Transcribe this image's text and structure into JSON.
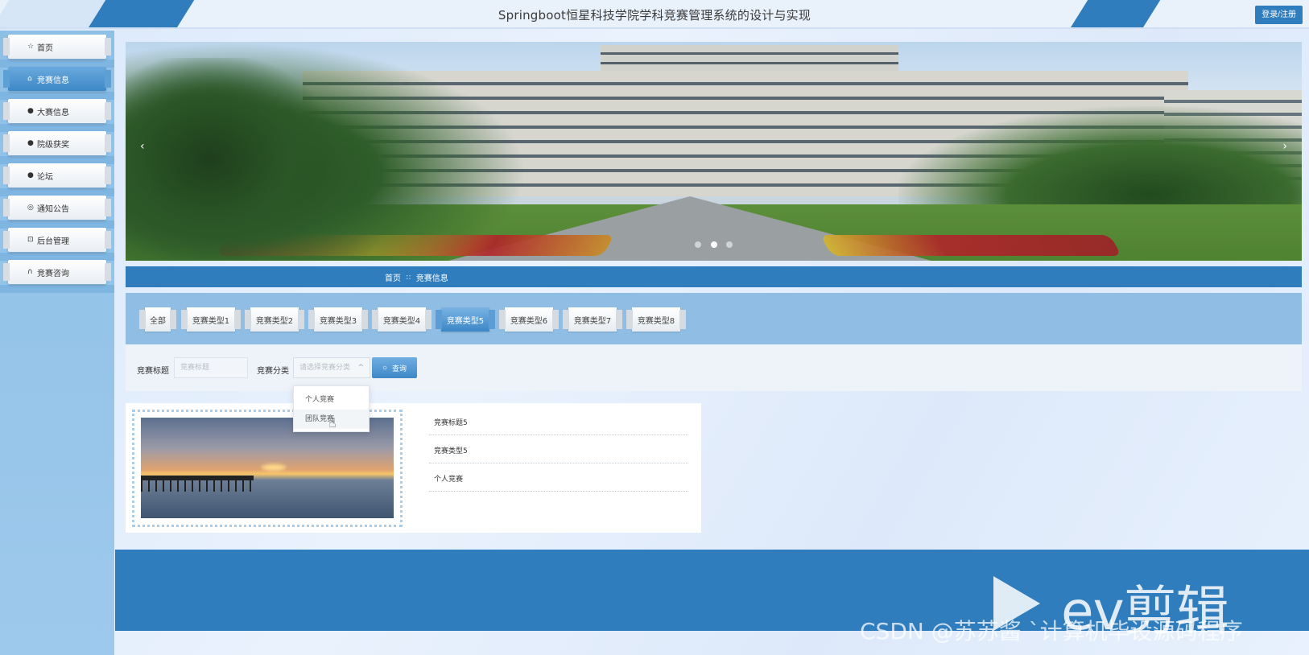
{
  "header": {
    "title": "Springboot恒星科技学院学科竞赛管理系统的设计与实现",
    "login_label": "登录/注册"
  },
  "sidebar": {
    "items": [
      {
        "label": "首页",
        "icon": "star-icon",
        "glyph": "☆"
      },
      {
        "label": "竞赛信息",
        "icon": "home-icon",
        "glyph": "⌂"
      },
      {
        "label": "大赛信息",
        "icon": "info-circle-icon",
        "glyph": "●"
      },
      {
        "label": "院级获奖",
        "icon": "question-circle-icon",
        "glyph": "●"
      },
      {
        "label": "论坛",
        "icon": "info-icon",
        "glyph": "●"
      },
      {
        "label": "通知公告",
        "icon": "settings-icon",
        "glyph": "◎"
      },
      {
        "label": "后台管理",
        "icon": "lock-icon",
        "glyph": "⊡"
      },
      {
        "label": "竞赛咨询",
        "icon": "headset-icon",
        "glyph": "∩"
      }
    ],
    "active_index": 1
  },
  "banner": {
    "prev_glyph": "‹",
    "next_glyph": "›",
    "slide_count": 3,
    "active_slide": 2
  },
  "breadcrumb": {
    "home": "首页",
    "separator": "::",
    "current": "竞赛信息"
  },
  "tabs": {
    "items": [
      "全部",
      "竞赛类型1",
      "竞赛类型2",
      "竞赛类型3",
      "竞赛类型4",
      "竞赛类型5",
      "竞赛类型6",
      "竞赛类型7",
      "竞赛类型8"
    ],
    "active_index": 5
  },
  "search": {
    "title_label": "竞赛标题",
    "title_placeholder": "竞赛标题",
    "category_label": "竞赛分类",
    "category_placeholder": "请选择竞赛分类",
    "chevron_glyph": "^",
    "query_label": "查询",
    "query_icon_glyph": "○"
  },
  "dropdown": {
    "options": [
      "个人竞赛",
      "团队竞赛"
    ],
    "hovered_index": 1
  },
  "result": {
    "title": "竞赛标题5",
    "type": "竞赛类型5",
    "category": "个人竞赛"
  },
  "watermark": {
    "brand": "ev剪辑",
    "credit": "CSDN @苏苏酱  `计算机毕设源码程序"
  },
  "colors": {
    "primary": "#2f7dbd",
    "sidebar_bg": "#8ec0e6",
    "tabs_bg": "#8fbde4"
  }
}
